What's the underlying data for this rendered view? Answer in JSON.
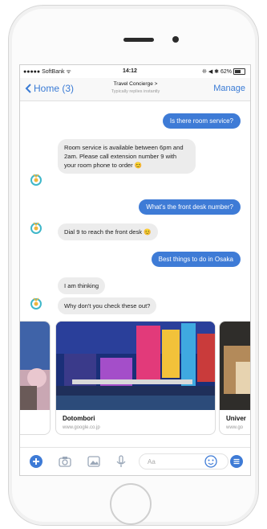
{
  "status": {
    "carrier": "●●●●● SoftBank ᯤ",
    "time": "14:12",
    "right": "❊ ◀ ✱ 62%"
  },
  "navbar": {
    "back_label": "Home (3)",
    "title": "Travel Concierge >",
    "subtitle": "Typically replies instantly",
    "manage_label": "Manage"
  },
  "messages": [
    {
      "from": "user",
      "text": "Is there room service?"
    },
    {
      "from": "bot",
      "text": "Room service is available between 6pm and 2am. Please call extension number 9 with your room phone to order 😊"
    },
    {
      "from": "user",
      "text": "What's the front desk number?"
    },
    {
      "from": "bot",
      "text": "Dial 9 to reach the front desk 😊"
    },
    {
      "from": "user",
      "text": "Best things to do in Osaka"
    },
    {
      "from": "bot",
      "text": "I am thinking"
    },
    {
      "from": "bot",
      "text": "Why don't you check these out?"
    }
  ],
  "cards": [
    {
      "title": "Dotombori",
      "url": "www.google.co.jp"
    },
    {
      "title": "Univer",
      "url": "www.go"
    }
  ],
  "input": {
    "placeholder": "Aa"
  },
  "colors": {
    "accent": "#3e7bd6",
    "bot_bubble": "#ececec",
    "nav_link": "#3a7bd5"
  }
}
